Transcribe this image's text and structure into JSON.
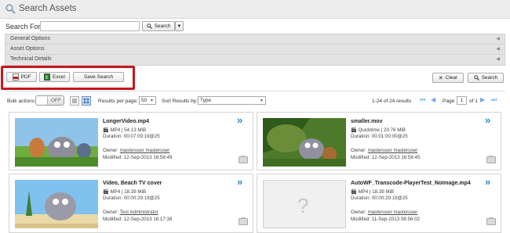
{
  "header": {
    "title": "Search Assets",
    "icon": "magnifier-icon"
  },
  "search": {
    "label": "Search For",
    "value": "",
    "placeholder": "",
    "button_label": "Search"
  },
  "options": {
    "rows": [
      "General Options",
      "Asset Options",
      "Technical Details"
    ]
  },
  "actions": {
    "pdf_label": "PDF",
    "excel_label": "Excel",
    "save_search_label": "Save Search",
    "clear_label": "Clear",
    "search_label": "Search",
    "highlight_color": "#c8161d"
  },
  "toolbar": {
    "bulk_label": "Bulk actions",
    "bulk_toggle": "OFF",
    "rpp_label": "Results per page:",
    "rpp_value": "50",
    "sort_label": "Sort Results by:",
    "sort_value": "Type",
    "results_text": "1-24 of 24 results",
    "page_label": "Page",
    "page_value": "1",
    "of_label": "of 1"
  },
  "cards": [
    {
      "title": "LongerVideo.mp4",
      "format": "MP4 | 54.13 MiB",
      "duration": "Duration: 00:07:09:19@25",
      "owner_label": "Owner:",
      "owner": "masteruser masteruser",
      "modified": "Modified: 12-Sep-2013 16:58:49"
    },
    {
      "title": "smaller.mov",
      "format": "Quicktime | 20.76 MiB",
      "duration": "Duration: 00:01:00:00@25",
      "owner_label": "Owner:",
      "owner": "masteruser masteruser",
      "modified": "Modified: 12-Sep-2013 16:58:45"
    },
    {
      "title": "Video, Beach TV cover",
      "format": "MP4 | 18.39 MiB",
      "duration": "Duration: 00:00:29:19@25",
      "owner_label": "Owner:",
      "owner": "Test Administrator",
      "modified": "Modified: 12-Sep-2013 16:17:38"
    },
    {
      "title": "AutoWF_Transcode-PlayerTest_NoImage.mp4",
      "format": "MP4 | 18.39 MiB",
      "duration": "Duration: 00:00:29:19@25",
      "owner_label": "Owner:",
      "owner": "masteruser masteruser",
      "modified": "Modified: 11-Sep-2013 08:56:02"
    }
  ],
  "colors": {
    "accent": "#2f8ad3",
    "pager": "#6ea6e6",
    "panel": "#e3e3e3"
  }
}
